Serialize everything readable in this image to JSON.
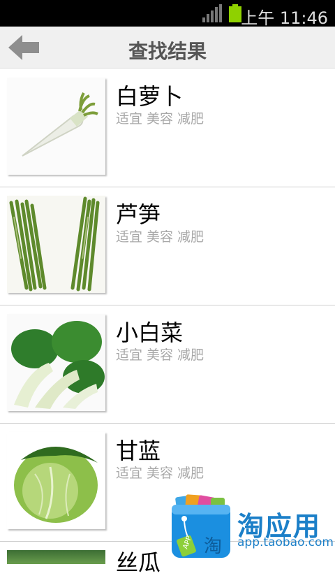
{
  "status_bar": {
    "time": "上午 11:46",
    "icons": [
      "signal-icon",
      "battery-icon"
    ]
  },
  "header": {
    "back_icon": "back-arrow-icon",
    "title": "查找结果"
  },
  "results": [
    {
      "name": "白萝卜",
      "tags": [
        "适宜",
        "美容",
        "减肥"
      ],
      "image": "white-radish"
    },
    {
      "name": "芦笋",
      "tags": [
        "适宜",
        "美容",
        "减肥"
      ],
      "image": "asparagus"
    },
    {
      "name": "小白菜",
      "tags": [
        "适宜",
        "美容",
        "减肥"
      ],
      "image": "bok-choy"
    },
    {
      "name": "甘蓝",
      "tags": [
        "适宜",
        "美容",
        "减肥"
      ],
      "image": "cabbage"
    },
    {
      "name": "丝瓜",
      "tags": [],
      "image": "loofah"
    }
  ],
  "ad": {
    "title": "淘应用",
    "url": "app.taobao.com",
    "badge": "APP",
    "bag_char": "淘"
  },
  "colors": {
    "title_bar_bg": "#f0f0f0",
    "title_text": "#555555",
    "tag_text": "#a8a8a8",
    "ad_blue": "#1b7fc8",
    "battery": "#8fd100"
  }
}
